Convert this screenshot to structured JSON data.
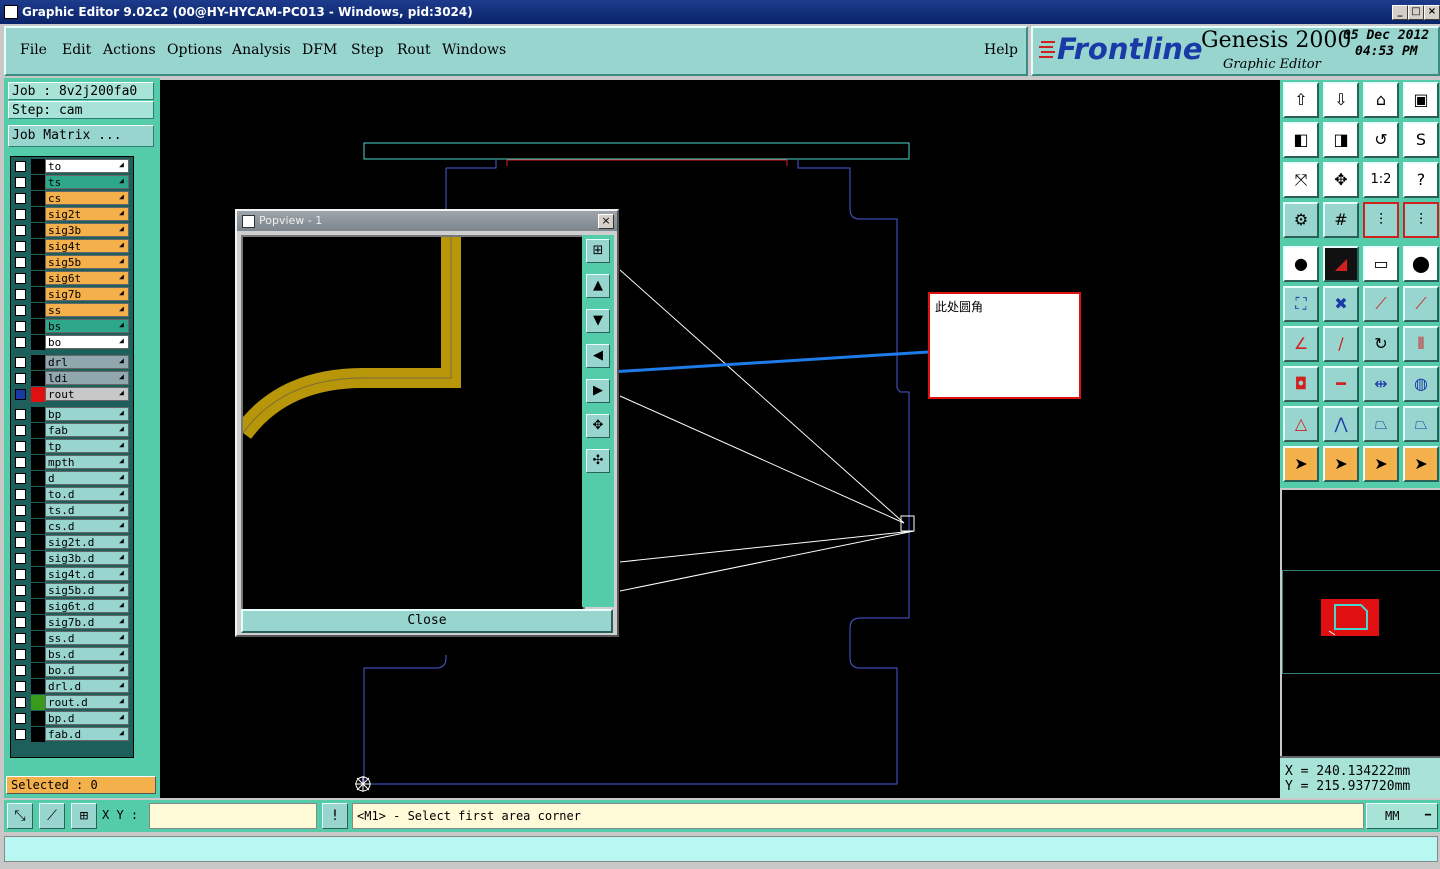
{
  "window": {
    "title": "Graphic Editor 9.02c2 (00@HY-HYCAM-PC013 - Windows, pid:3024)"
  },
  "menu": [
    "File",
    "Edit",
    "Actions",
    "Options",
    "Analysis",
    "DFM",
    "Step",
    "Rout",
    "Windows"
  ],
  "help_label": "Help",
  "brand": {
    "logo": "Frontline",
    "product": "Genesis 2000",
    "subtitle": "Graphic Editor",
    "date": "05 Dec 2012",
    "time": "04:53 PM"
  },
  "job": {
    "job_label": "Job : 8v2j200fa0",
    "step_label": "Step: cam",
    "matrix_button": "Job Matrix ..."
  },
  "layers": [
    {
      "name": "to",
      "color": "#ffffff"
    },
    {
      "name": "ts",
      "color": "#2ea88a"
    },
    {
      "name": "cs",
      "color": "#f4b04a"
    },
    {
      "name": "sig2t",
      "color": "#f4b04a"
    },
    {
      "name": "sig3b",
      "color": "#f4b04a"
    },
    {
      "name": "sig4t",
      "color": "#f4b04a"
    },
    {
      "name": "sig5b",
      "color": "#f4b04a"
    },
    {
      "name": "sig6t",
      "color": "#f4b04a"
    },
    {
      "name": "sig7b",
      "color": "#f4b04a"
    },
    {
      "name": "ss",
      "color": "#f4b04a"
    },
    {
      "name": "bs",
      "color": "#2ea88a"
    },
    {
      "name": "bo",
      "color": "#ffffff"
    },
    {
      "name": "drl",
      "color": "#8fa7ad"
    },
    {
      "name": "ldi",
      "color": "#8fa7ad"
    },
    {
      "name": "rout",
      "color": "#c8c8c8"
    },
    {
      "name": "bp",
      "color": "#99d5cf"
    },
    {
      "name": "fab",
      "color": "#99d5cf"
    },
    {
      "name": "tp",
      "color": "#99d5cf"
    },
    {
      "name": "mpth",
      "color": "#99d5cf"
    },
    {
      "name": "d",
      "color": "#99d5cf"
    },
    {
      "name": "to.d",
      "color": "#99d5cf"
    },
    {
      "name": "ts.d",
      "color": "#99d5cf"
    },
    {
      "name": "cs.d",
      "color": "#99d5cf"
    },
    {
      "name": "sig2t.d",
      "color": "#99d5cf"
    },
    {
      "name": "sig3b.d",
      "color": "#99d5cf"
    },
    {
      "name": "sig4t.d",
      "color": "#99d5cf"
    },
    {
      "name": "sig5b.d",
      "color": "#99d5cf"
    },
    {
      "name": "sig6t.d",
      "color": "#99d5cf"
    },
    {
      "name": "sig7b.d",
      "color": "#99d5cf"
    },
    {
      "name": "ss.d",
      "color": "#99d5cf"
    },
    {
      "name": "bs.d",
      "color": "#99d5cf"
    },
    {
      "name": "bo.d",
      "color": "#99d5cf"
    },
    {
      "name": "drl.d",
      "color": "#99d5cf"
    },
    {
      "name": "rout.d",
      "color": "#99d5cf"
    },
    {
      "name": "bp.d",
      "color": "#99d5cf"
    },
    {
      "name": "fab.d",
      "color": "#99d5cf"
    }
  ],
  "selected_label": "Selected : 0",
  "popview": {
    "title": "Popview - 1",
    "close_label": "Close"
  },
  "annotation": {
    "text": "此处圆角"
  },
  "coords": {
    "x": "X = 240.134222mm",
    "y": "Y = 215.937720mm"
  },
  "command": {
    "xy_label": "X Y :",
    "prompt": "<M1> - Select first area corner",
    "unit": "MM"
  }
}
